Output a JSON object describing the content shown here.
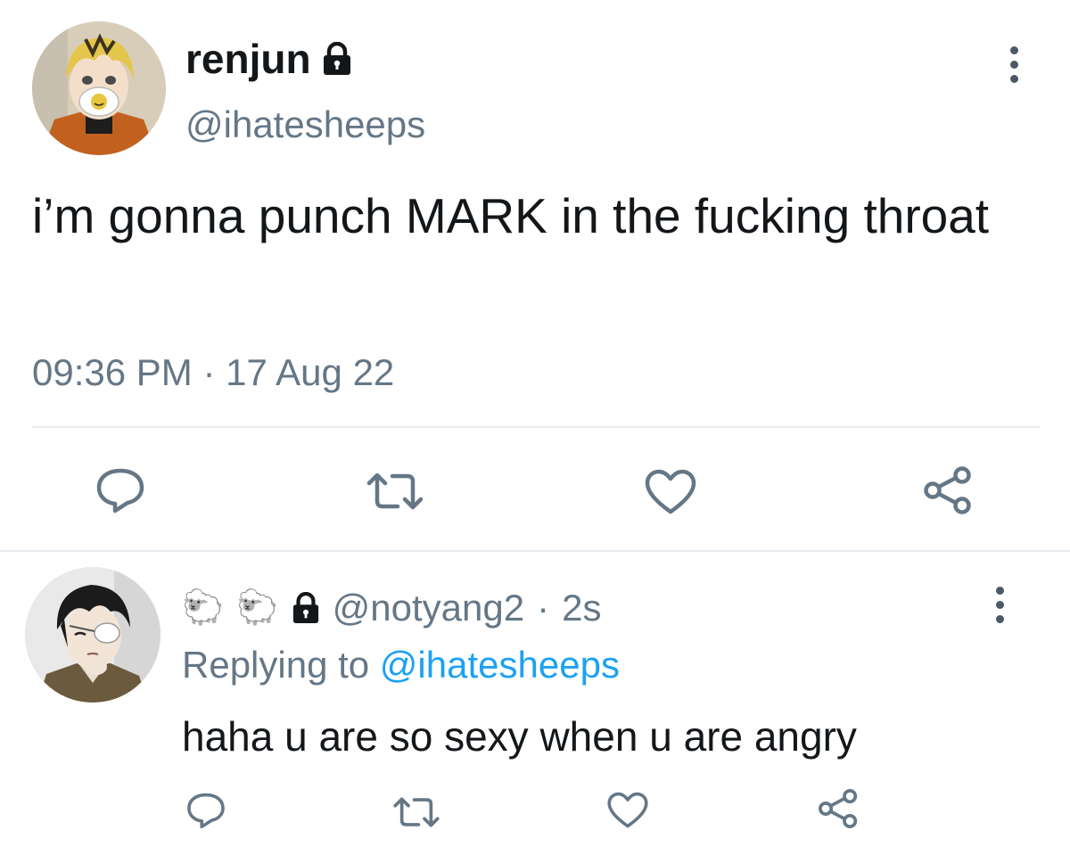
{
  "tweet": {
    "display_name": "renjun",
    "handle": "@ihatesheeps",
    "text": "i’m gonna punch MARK in the fucking throat",
    "timestamp": "09:36 PM · 17 Aug 22",
    "locked": true
  },
  "reply": {
    "name_emoji": [
      "🐑",
      "🐑"
    ],
    "handle": "@notyang2",
    "time_sep": "·",
    "time": "2s",
    "replying_prefix": "Replying to",
    "replying_handle": "@ihatesheeps",
    "text": "haha u are so sexy when u are angry",
    "locked": true
  },
  "actions": [
    "reply-icon",
    "retweet-icon",
    "like-icon",
    "share-icon"
  ],
  "colors": {
    "text_primary": "#14171a",
    "text_secondary": "#657786",
    "link": "#1da1f2",
    "icon": "#657786",
    "divider": "#e6ecf0"
  }
}
